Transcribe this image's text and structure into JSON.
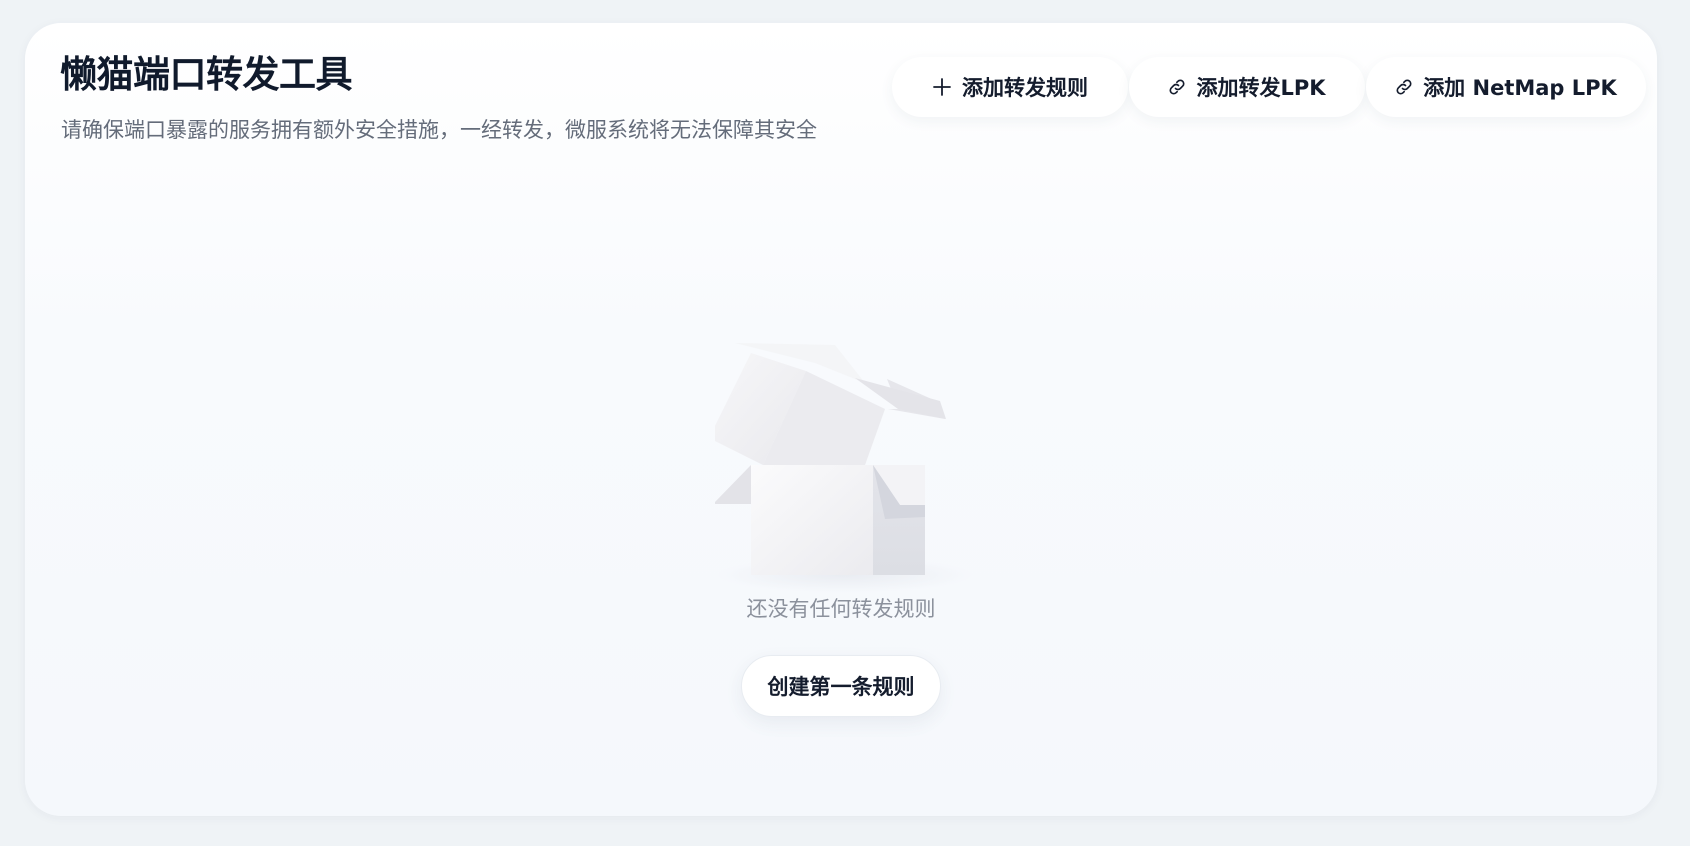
{
  "header": {
    "title": "懒猫端口转发工具",
    "subtitle": "请确保端口暴露的服务拥有额外安全措施，一经转发，微服系统将无法保障其安全"
  },
  "toolbar": {
    "add_rule_label": "添加转发规则",
    "add_rule_icon": "plus-icon",
    "add_lpk_label": "添加转发LPK",
    "add_lpk_icon": "link-icon",
    "add_netmap_label": "添加 NetMap LPK",
    "add_netmap_icon": "link-icon"
  },
  "empty_state": {
    "illustration": "open-box",
    "message": "还没有任何转发规则",
    "create_label": "创建第一条规则"
  },
  "colors": {
    "background": "#eff3f6",
    "card": "#ffffff",
    "text_primary": "#101a2c",
    "text_secondary": "#646c7a",
    "text_muted": "#8b919c"
  }
}
